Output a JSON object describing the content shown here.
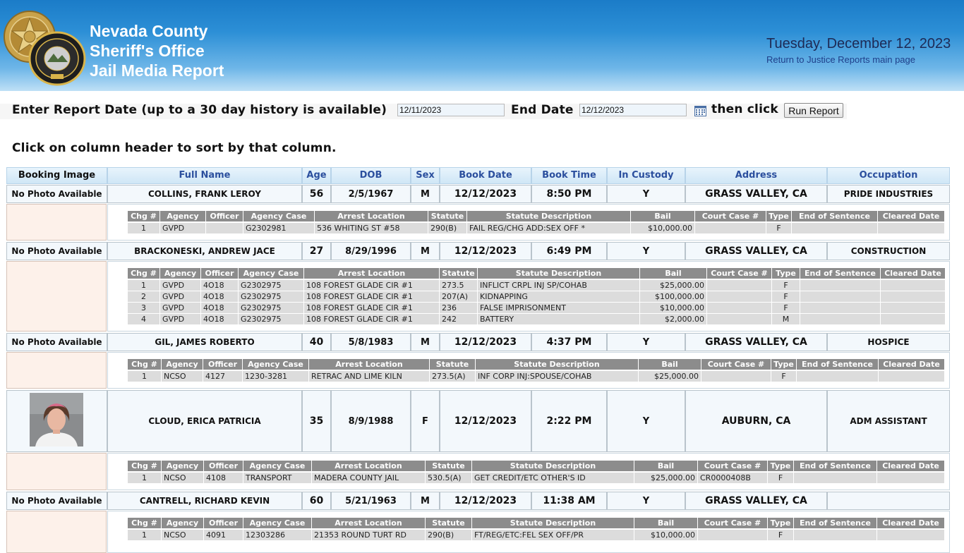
{
  "header": {
    "title_lines": [
      "Nevada County",
      "Sheriff's Office",
      "Jail Media Report"
    ],
    "date": "Tuesday, December 12, 2023",
    "return_link": "Return to Justice Reports main page",
    "logos": [
      "sheriff-star-badge",
      "nevada-county-sheriff-patch"
    ]
  },
  "form": {
    "start_label": "Enter Report Date (up to a 30 day history is available)",
    "start_value": "12/11/2023",
    "end_label": "End Date",
    "end_value": "12/12/2023",
    "then_click_label": "then click",
    "run_button": "Run Report",
    "calendar_icon": "calendar-icon"
  },
  "sort_note": "Click on column header to sort by that column.",
  "columns": [
    "Booking Image",
    "Full Name",
    "Age",
    "DOB",
    "Sex",
    "Book Date",
    "Book Time",
    "In Custody",
    "Address",
    "Occupation"
  ],
  "charge_columns": [
    "Chg #",
    "Agency",
    "Officer",
    "Agency Case",
    "Arrest Location",
    "Statute",
    "Statute Description",
    "Bail",
    "Court Case #",
    "Type",
    "End of Sentence",
    "Cleared Date"
  ],
  "bookings": [
    {
      "image": "No Photo Available",
      "name": "COLLINS, FRANK LEROY",
      "age": "56",
      "dob": "2/5/1967",
      "sex": "M",
      "book_date": "12/12/2023",
      "book_time": "8:50 PM",
      "in_custody": "Y",
      "address": "GRASS VALLEY, CA",
      "occupation": "PRIDE INDUSTRIES",
      "charges": [
        [
          "1",
          "GVPD",
          "",
          "G2302981",
          "536 WHITING ST #58",
          "290(B)",
          "FAIL REG/CHG ADD:SEX OFF *",
          "$10,000.00",
          "",
          "F",
          "",
          ""
        ]
      ]
    },
    {
      "image": "No Photo Available",
      "name": "BRACKONESKI, ANDREW JACE",
      "age": "27",
      "dob": "8/29/1996",
      "sex": "M",
      "book_date": "12/12/2023",
      "book_time": "6:49 PM",
      "in_custody": "Y",
      "address": "GRASS VALLEY, CA",
      "occupation": "CONSTRUCTION",
      "charges": [
        [
          "1",
          "GVPD",
          "4O18",
          "G2302975",
          "108 FOREST GLADE CIR #1",
          "273.5",
          "INFLICT CRPL INJ SP/COHAB",
          "$25,000.00",
          "",
          "F",
          "",
          ""
        ],
        [
          "2",
          "GVPD",
          "4O18",
          "G2302975",
          "108 FOREST GLADE CIR #1",
          "207(A)",
          "KIDNAPPING",
          "$100,000.00",
          "",
          "F",
          "",
          ""
        ],
        [
          "3",
          "GVPD",
          "4O18",
          "G2302975",
          "108 FOREST GLADE CIR #1",
          "236",
          "FALSE IMPRISONMENT",
          "$10,000.00",
          "",
          "F",
          "",
          ""
        ],
        [
          "4",
          "GVPD",
          "4O18",
          "G2302975",
          "108 FOREST GLADE CIR #1",
          "242",
          "BATTERY",
          "$2,000.00",
          "",
          "M",
          "",
          ""
        ]
      ]
    },
    {
      "image": "No Photo Available",
      "name": "GIL, JAMES ROBERTO",
      "age": "40",
      "dob": "5/8/1983",
      "sex": "M",
      "book_date": "12/12/2023",
      "book_time": "4:37 PM",
      "in_custody": "Y",
      "address": "GRASS VALLEY, CA",
      "occupation": "HOSPICE",
      "charges": [
        [
          "1",
          "NCSO",
          "4127",
          "1230-3281",
          "RETRAC AND LIME KILN",
          "273.5(A)",
          "INF CORP INJ:SPOUSE/COHAB",
          "$25,000.00",
          "",
          "F",
          "",
          ""
        ]
      ]
    },
    {
      "image": "",
      "name": "CLOUD, ERICA PATRICIA",
      "age": "35",
      "dob": "8/9/1988",
      "sex": "F",
      "book_date": "12/12/2023",
      "book_time": "2:22 PM",
      "in_custody": "Y",
      "address": "AUBURN, CA",
      "occupation": "ADM ASSISTANT",
      "charges": [
        [
          "1",
          "NCSO",
          "4108",
          "TRANSPORT",
          "MADERA COUNTY JAIL",
          "530.5(A)",
          "GET CREDIT/ETC OTHER'S ID",
          "$25,000.00",
          "CR0000408B",
          "F",
          "",
          ""
        ]
      ]
    },
    {
      "image": "No Photo Available",
      "name": "CANTRELL, RICHARD KEVIN",
      "age": "60",
      "dob": "5/21/1963",
      "sex": "M",
      "book_date": "12/12/2023",
      "book_time": "11:38 AM",
      "in_custody": "Y",
      "address": "GRASS VALLEY, CA",
      "occupation": "",
      "charges": [
        [
          "1",
          "NCSO",
          "4091",
          "12303286",
          "21353 ROUND TURT RD",
          "290(B)",
          "FT/REG/ETC:FEL SEX OFF/PR",
          "$10,000.00",
          "",
          "F",
          "",
          ""
        ]
      ]
    }
  ]
}
